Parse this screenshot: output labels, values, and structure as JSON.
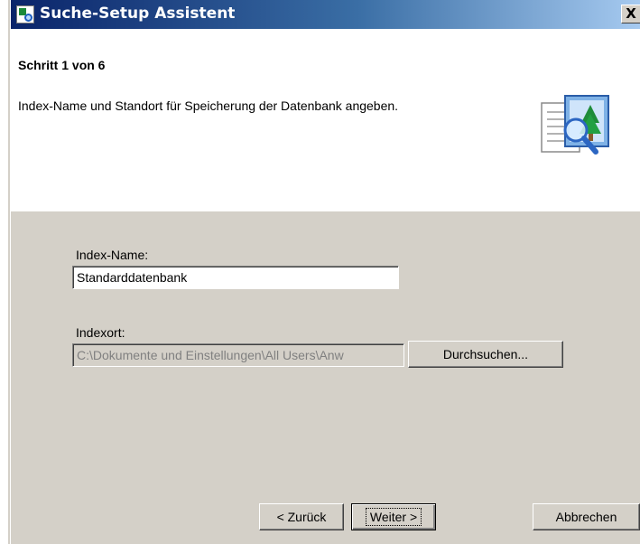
{
  "window": {
    "title": "Suche-Setup Assistent",
    "close_glyph": "X",
    "icon": "search-setup-icon"
  },
  "header": {
    "step": "Schritt 1 von 6",
    "description": "Index-Name und Standort für Speicherung der Datenbank angeben.",
    "icon": "search-magnifier-document-icon"
  },
  "form": {
    "index_name_label": "Index-Name:",
    "index_name_value": "Standarddatenbank",
    "index_location_label": "Indexort:",
    "index_location_value": "C:\\Dokumente und Einstellungen\\All Users\\Anw",
    "browse_label": "Durchsuchen..."
  },
  "footer": {
    "back_label": "< Zurück",
    "next_label": "Weiter >",
    "cancel_label": "Abbrechen"
  },
  "colors": {
    "titlebar_start": "#0a246a",
    "titlebar_end": "#a6caf0",
    "dialog_face": "#d4d0c8"
  }
}
